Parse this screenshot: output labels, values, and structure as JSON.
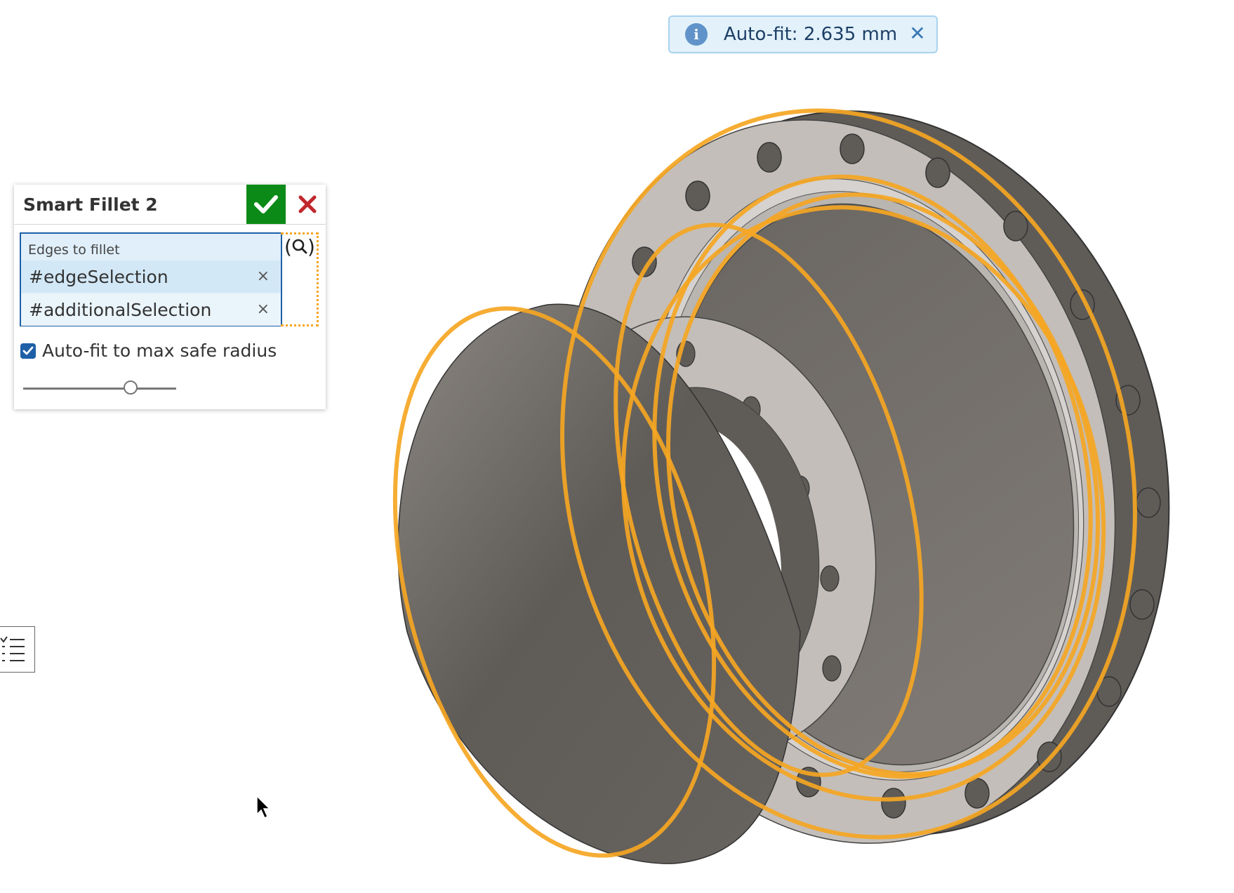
{
  "toast": {
    "message": "Auto-fit: 2.635 mm",
    "info_icon": "i"
  },
  "dialog": {
    "title": "Smart Fillet 2",
    "query_label": "Edges to fillet",
    "selections": [
      "#edgeSelection",
      "#additionalSelection"
    ],
    "remove_glyph": "×",
    "search_glyph": "(🔍)",
    "autofit_label": "Auto-fit to max safe radius",
    "autofit_checked": true,
    "slider_value": 0.7
  },
  "viewport": {
    "model_name": "flanged pipe reducer",
    "highlight_color": "#f5a623",
    "flange_face_color": "#c3beba",
    "pipe_dark_color": "#5f5c58"
  }
}
